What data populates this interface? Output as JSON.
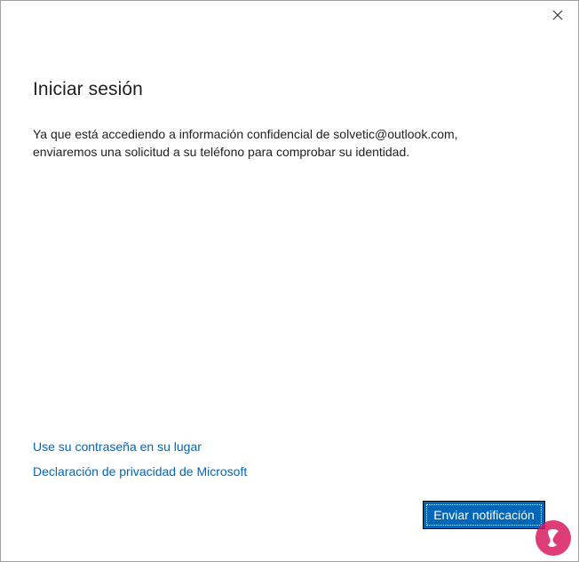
{
  "dialog": {
    "title": "Iniciar sesión",
    "message_line1": "Ya que está accediendo a información confidencial de solvetic@outlook.com,",
    "message_line2": "enviaremos una solicitud a su teléfono para comprobar su identidad.",
    "use_password_link": "Use su contraseña en su lugar",
    "privacy_link": "Declaración de privacidad de Microsoft",
    "send_button": "Enviar notificación",
    "close_icon": "close-icon"
  },
  "colors": {
    "link": "#0067b8",
    "button": "#0067b8",
    "text": "#1f1f1f"
  }
}
